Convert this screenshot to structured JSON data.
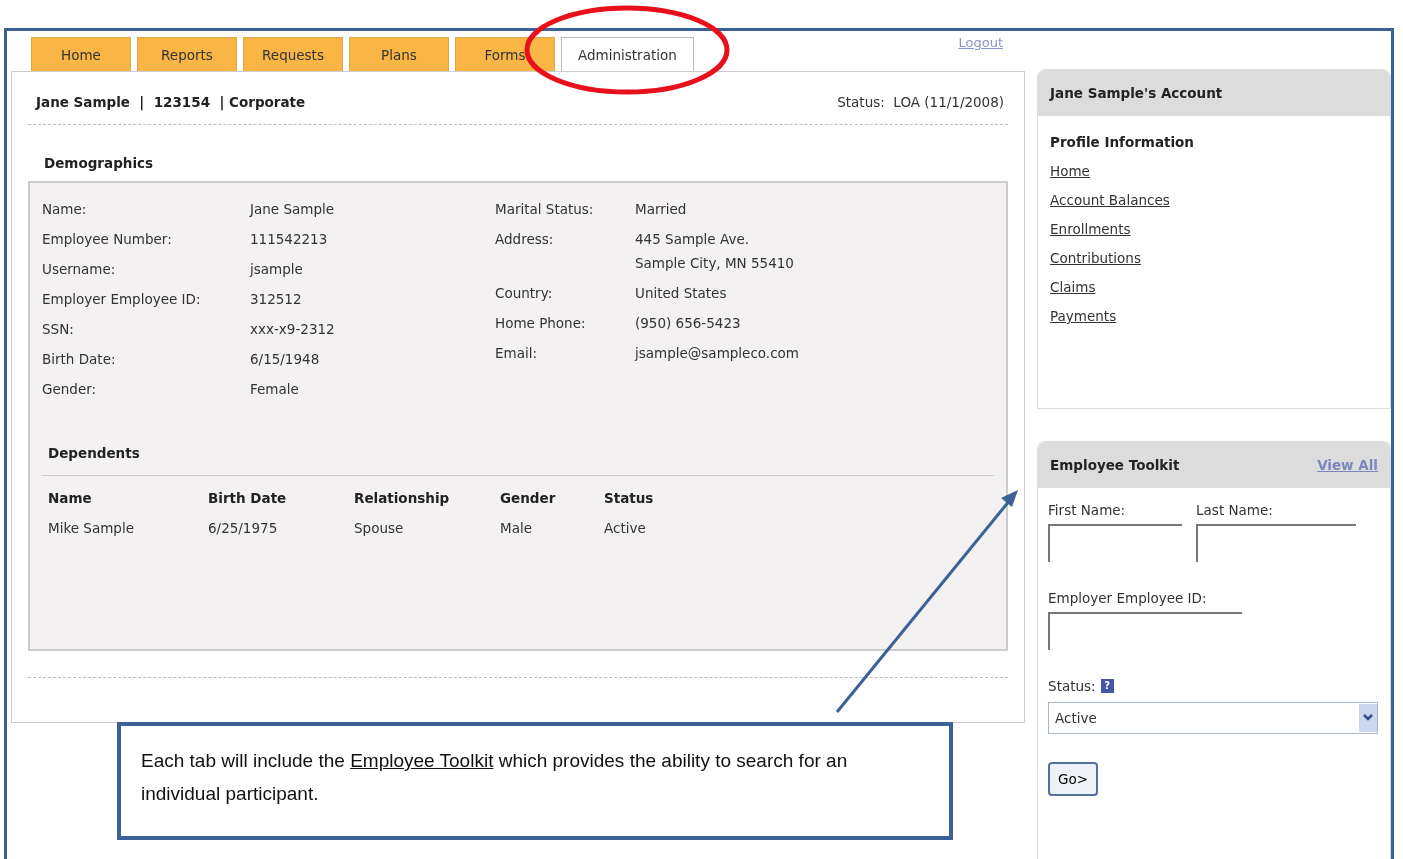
{
  "tabs": [
    {
      "label": "Home",
      "selected": false
    },
    {
      "label": "Reports",
      "selected": false
    },
    {
      "label": "Requests",
      "selected": false
    },
    {
      "label": "Plans",
      "selected": false
    },
    {
      "label": "Forms",
      "selected": false
    },
    {
      "label": "Administration",
      "selected": true
    }
  ],
  "logout": "Logout",
  "header": {
    "identity": "Jane Sample  |  123154  | Corporate",
    "status": "Status:  LOA (11/1/2008)"
  },
  "demographics": {
    "title": "Demographics",
    "left": [
      {
        "label": "Name:",
        "value": [
          "Jane Sample"
        ]
      },
      {
        "label": "Employee Number:",
        "value": [
          "111542213"
        ]
      },
      {
        "label": "Username:",
        "value": [
          "jsample"
        ]
      },
      {
        "label": "Employer Employee ID:",
        "value": [
          "312512"
        ]
      },
      {
        "label": "SSN:",
        "value": [
          "xxx-x9-2312"
        ]
      },
      {
        "label": "Birth Date:",
        "value": [
          "6/15/1948"
        ]
      },
      {
        "label": "Gender:",
        "value": [
          "Female"
        ]
      }
    ],
    "right": [
      {
        "label": "Marital Status:",
        "value": [
          "Married"
        ]
      },
      {
        "label": "Address:",
        "value": [
          "445 Sample Ave.",
          "Sample City, MN  55410"
        ]
      },
      {
        "label": "Country:",
        "value": [
          "United States"
        ]
      },
      {
        "label": "Home Phone:",
        "value": [
          "(950) 656-5423"
        ]
      },
      {
        "label": "Email:",
        "value": [
          "jsample@sampleco.com"
        ]
      }
    ]
  },
  "dependents": {
    "title": "Dependents",
    "columns": [
      "Name",
      "Birth Date",
      "Relationship",
      "Gender",
      "Status"
    ],
    "rows": [
      [
        "Mike Sample",
        "6/25/1975",
        "Spouse",
        "Male",
        "Active"
      ]
    ]
  },
  "account": {
    "title": "Jane Sample's Account",
    "section": "Profile Information",
    "links": [
      "Home",
      "Account Balances",
      "Enrollments",
      "Contributions",
      "Claims",
      "Payments"
    ]
  },
  "toolkit": {
    "title": "Employee Toolkit",
    "view_all": "View All",
    "first_name": "First Name:",
    "last_name": "Last Name:",
    "employer_id": "Employer Employee ID:",
    "status_label": "Status:",
    "help": "?",
    "status_value": "Active",
    "go": "Go>"
  },
  "callout": {
    "before": "Each tab will include the ",
    "link": "Employee Toolkit",
    "after": " which provides the ability to search for an individual participant."
  }
}
